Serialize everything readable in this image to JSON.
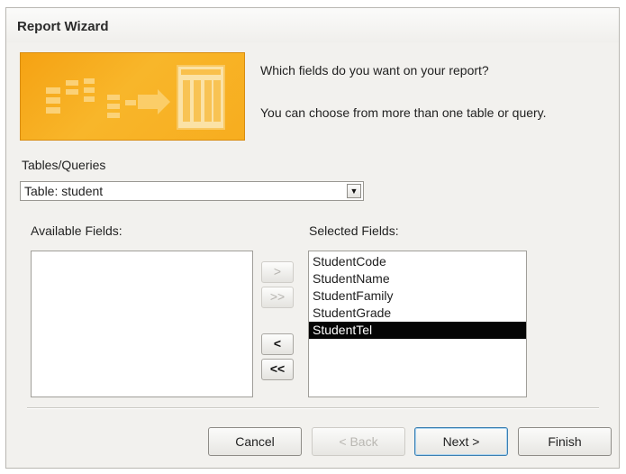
{
  "window": {
    "title": "Report Wizard"
  },
  "prompt": {
    "question": "Which fields do you want on your report?",
    "hint": "You can choose from more than one table or query."
  },
  "tables_queries": {
    "label": "Tables/Queries",
    "selected": "Table: student"
  },
  "available_fields": {
    "label": "Available Fields:",
    "items": []
  },
  "selected_fields": {
    "label": "Selected Fields:",
    "items": [
      "StudentCode",
      "StudentName",
      "StudentFamily",
      "StudentGrade",
      "StudentTel"
    ],
    "selected_item": "StudentTel"
  },
  "move_buttons": {
    "add_one": ">",
    "add_all": ">>",
    "remove_one": "<",
    "remove_all": "<<"
  },
  "footer": {
    "cancel": "Cancel",
    "back": "< Back",
    "next": "Next >",
    "finish": "Finish"
  },
  "colors": {
    "illustration": "#f5a213",
    "selection": "#050505"
  }
}
